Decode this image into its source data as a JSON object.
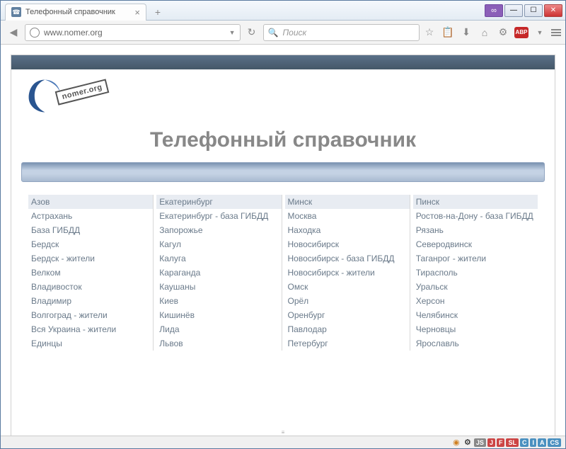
{
  "window": {
    "tab_title": "Телефонный справочник",
    "new_tab": "+",
    "ext_label": "∞"
  },
  "toolbar": {
    "url": "www.nomer.org",
    "search_placeholder": "Поиск",
    "abp": "ABP"
  },
  "page": {
    "logo_text": "nomer.org",
    "title": "Телефонный справочник"
  },
  "cities": {
    "col1": [
      "Азов",
      "Астрахань",
      "База ГИБДД",
      "Бердск",
      "Бердск - жители",
      "Велком",
      "Владивосток",
      "Владимир",
      "Волгоград - жители",
      "Вся Украина - жители",
      "Единцы"
    ],
    "col2": [
      "Екатеринбург",
      "Екатеринбург - база ГИБДД",
      "Запорожье",
      "Кагул",
      "Калуга",
      "Караганда",
      "Каушаны",
      "Киев",
      "Кишинёв",
      "Лида",
      "Львов"
    ],
    "col3": [
      "Минск",
      "Москва",
      "Находка",
      "Новосибирск",
      "Новосибирск - база ГИБДД",
      "Новосибирск - жители",
      "Омск",
      "Орёл",
      "Оренбург",
      "Павлодар",
      "Петербург"
    ],
    "col4": [
      "Пинск",
      "Ростов-на-Дону - база ГИБДД",
      "Рязань",
      "Северодвинск",
      "Таганрог - жители",
      "Тирасполь",
      "Уральск",
      "Херсон",
      "Челябинск",
      "Черновцы",
      "Ярославль"
    ]
  },
  "status_badges": [
    {
      "t": "JS",
      "c": "#888"
    },
    {
      "t": "J",
      "c": "#c44"
    },
    {
      "t": "F",
      "c": "#c44"
    },
    {
      "t": "SL",
      "c": "#c44"
    },
    {
      "t": "C",
      "c": "#4a90c0"
    },
    {
      "t": "I",
      "c": "#4a90c0"
    },
    {
      "t": "A",
      "c": "#4a90c0"
    },
    {
      "t": "CS",
      "c": "#4a90c0"
    }
  ]
}
